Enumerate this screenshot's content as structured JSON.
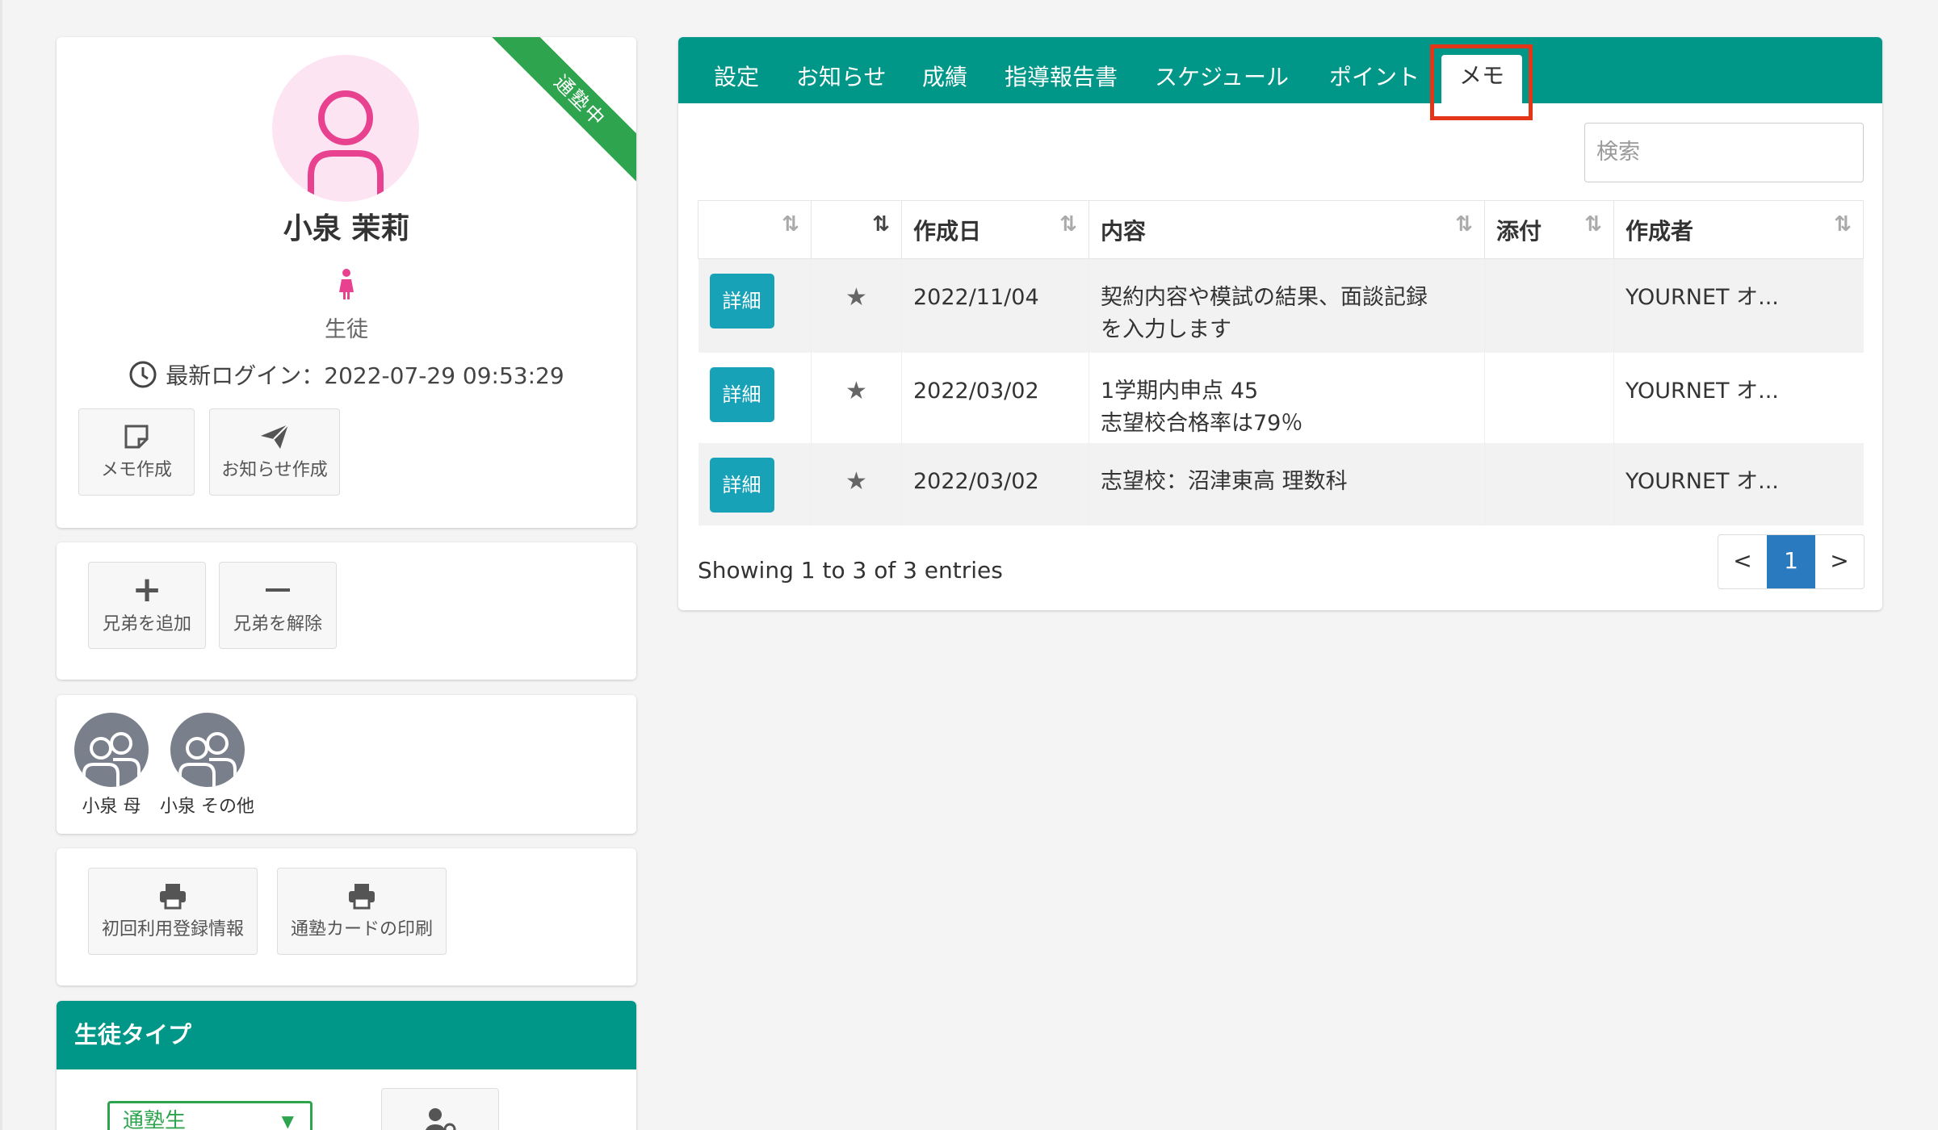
{
  "profile": {
    "status_ribbon": "通塾中",
    "name": "小泉 茉莉",
    "role": "生徒",
    "last_login": "最新ログイン：2022-07-29 09:53:29",
    "actions": [
      {
        "label": "メモ作成",
        "icon": "note-icon"
      },
      {
        "label": "お知らせ作成",
        "icon": "paper-plane-icon"
      }
    ]
  },
  "siblings": {
    "add_label": "兄弟を追加",
    "remove_label": "兄弟を解除"
  },
  "family": [
    {
      "name": "小泉 母"
    },
    {
      "name": "小泉 その他"
    }
  ],
  "print": {
    "first_registration": "初回利用登録情報",
    "card_print": "通塾カードの印刷"
  },
  "student_type": {
    "title": "生徒タイプ",
    "selected": "通塾生"
  },
  "tabs": [
    {
      "label": "設定"
    },
    {
      "label": "お知らせ"
    },
    {
      "label": "成績"
    },
    {
      "label": "指導報告書"
    },
    {
      "label": "スケジュール"
    },
    {
      "label": "ポイント"
    },
    {
      "label": "メモ"
    }
  ],
  "search": {
    "placeholder": "検索"
  },
  "table": {
    "headers": [
      "",
      "",
      "作成日",
      "内容",
      "添付",
      "作成者"
    ],
    "detail_label": "詳細",
    "rows": [
      {
        "date": "2022/11/04",
        "content_line1": "契約内容や模試の結果、面談記録",
        "content_line2": "を入力します",
        "attach": "",
        "author": "YOURNET オ..."
      },
      {
        "date": "2022/03/02",
        "content_line1": "1学期内申点 45",
        "content_line2": "志望校合格率は79％",
        "attach": "",
        "author": "YOURNET オ..."
      },
      {
        "date": "2022/03/02",
        "content_line1": "志望校：沼津東高 理数科",
        "content_line2": "",
        "attach": "",
        "author": "YOURNET オ..."
      }
    ]
  },
  "pagination": {
    "showing": "Showing 1 to 3 of 3 entries",
    "prev": "<",
    "current": "1",
    "next": ">"
  },
  "colors": {
    "brand": "#009688",
    "highlight": "#e53518",
    "ribbon": "#2ea44f",
    "button": "#17a2b8"
  }
}
